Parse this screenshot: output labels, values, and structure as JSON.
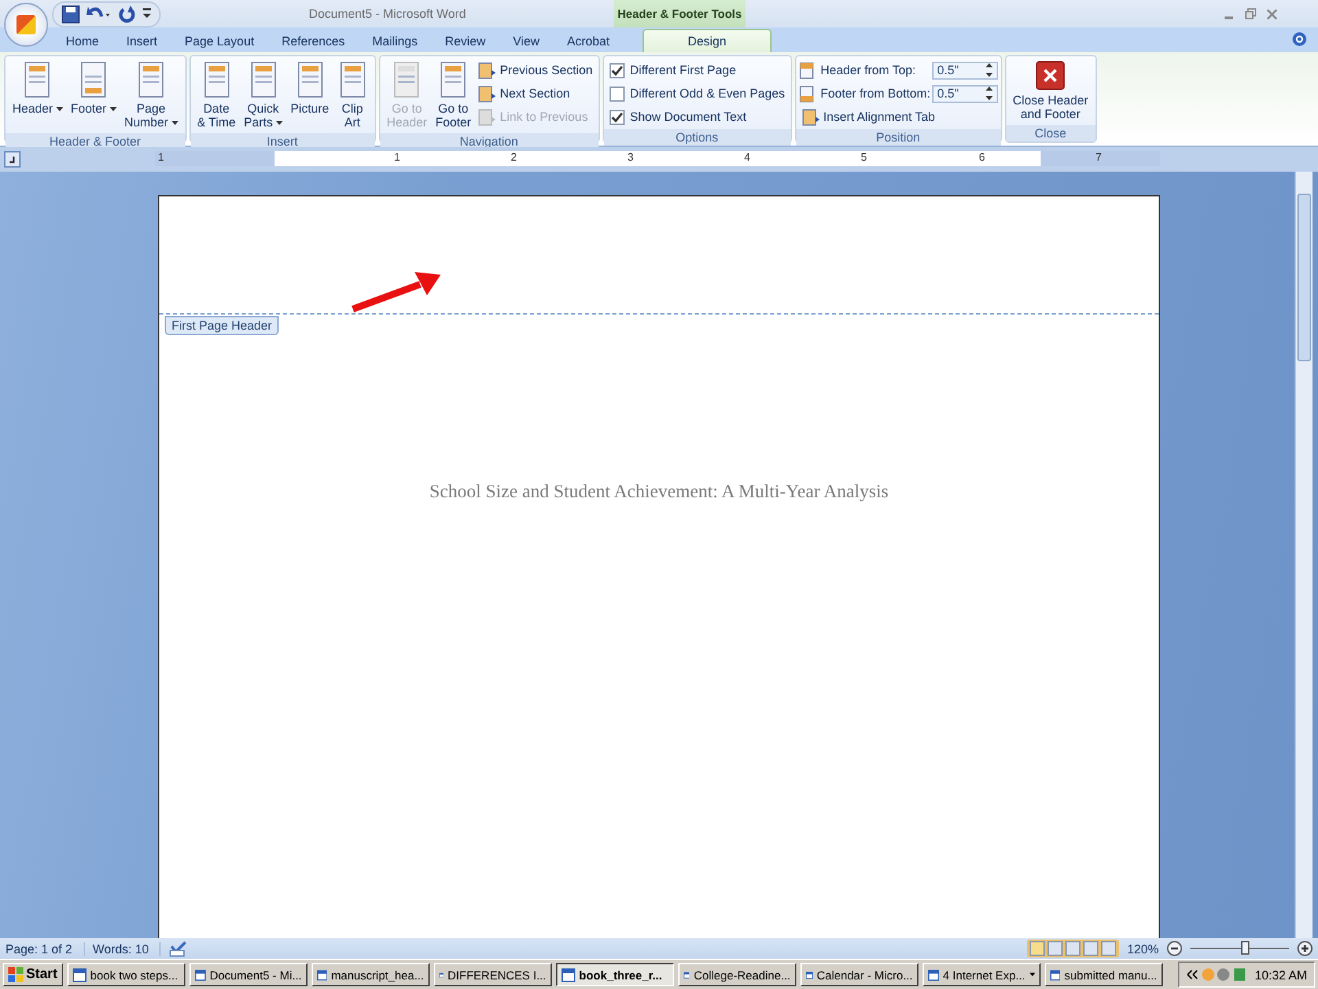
{
  "window": {
    "title": "Document5 - Microsoft Word",
    "context_group": "Header & Footer Tools"
  },
  "tabs": [
    {
      "label": "Home",
      "selected": false
    },
    {
      "label": "Insert",
      "selected": false
    },
    {
      "label": "Page Layout",
      "selected": false
    },
    {
      "label": "References",
      "selected": false
    },
    {
      "label": "Mailings",
      "selected": false
    },
    {
      "label": "Review",
      "selected": false
    },
    {
      "label": "View",
      "selected": false
    },
    {
      "label": "Acrobat",
      "selected": false
    },
    {
      "label": "Design",
      "selected": true
    }
  ],
  "ribbon": [
    {
      "label": "Header & Footer",
      "items": [
        {
          "kind": "large",
          "lines": [
            "Header"
          ],
          "dropdown": true,
          "disabled": false
        },
        {
          "kind": "large",
          "lines": [
            "Footer"
          ],
          "dropdown": true,
          "disabled": false
        },
        {
          "kind": "large",
          "lines": [
            "Page",
            "Number"
          ],
          "dropdown": true,
          "disabled": false
        }
      ]
    },
    {
      "label": "Insert",
      "items": [
        {
          "kind": "large",
          "lines": [
            "Date",
            "& Time"
          ],
          "dropdown": false,
          "disabled": false
        },
        {
          "kind": "large",
          "lines": [
            "Quick",
            "Parts"
          ],
          "dropdown": true,
          "disabled": false
        },
        {
          "kind": "large",
          "lines": [
            "Picture"
          ],
          "dropdown": false,
          "disabled": false
        },
        {
          "kind": "large",
          "lines": [
            "Clip",
            "Art"
          ],
          "dropdown": false,
          "disabled": false
        }
      ]
    },
    {
      "label": "Navigation",
      "items": [
        {
          "kind": "large",
          "lines": [
            "Go to",
            "Header"
          ],
          "dropdown": false,
          "disabled": true
        },
        {
          "kind": "large",
          "lines": [
            "Go to",
            "Footer"
          ],
          "dropdown": false,
          "disabled": false
        },
        {
          "kind": "small",
          "label": "Previous Section",
          "disabled": false
        },
        {
          "kind": "small",
          "label": "Next Section",
          "disabled": false
        },
        {
          "kind": "small",
          "label": "Link to Previous",
          "disabled": true
        }
      ]
    },
    {
      "label": "Options",
      "items": [
        {
          "kind": "checkbox",
          "label": "Different First Page",
          "checked": true
        },
        {
          "kind": "checkbox",
          "label": "Different Odd & Even Pages",
          "checked": false
        },
        {
          "kind": "checkbox",
          "label": "Show Document Text",
          "checked": true
        }
      ]
    },
    {
      "label": "Position",
      "items": [
        {
          "kind": "spin",
          "label": "Header from Top:",
          "value": "0.5\""
        },
        {
          "kind": "spin",
          "label": "Footer from Bottom:",
          "value": "0.5\""
        },
        {
          "kind": "small",
          "label": "Insert Alignment Tab",
          "disabled": false
        }
      ]
    },
    {
      "label": "Close",
      "items": [
        {
          "kind": "close",
          "lines": [
            "Close Header",
            "and Footer"
          ],
          "dropdown": false,
          "disabled": false
        }
      ]
    }
  ],
  "ruler": {
    "numbers": [
      "1",
      "1",
      "2",
      "3",
      "4",
      "5",
      "6",
      "7"
    ]
  },
  "document": {
    "header_tag": "First Page Header",
    "title": "School Size and Student Achievement: A Multi-Year Analysis"
  },
  "status_bar": {
    "page": "Page: 1 of 2",
    "words": "Words: 10",
    "zoom": "120%",
    "level": 0.55
  },
  "taskbar": {
    "start": "Start",
    "clock": "10:32 AM",
    "items": [
      {
        "label": "book two steps...",
        "selected": false,
        "dropdown": false
      },
      {
        "label": "Document5 - Mi...",
        "selected": false,
        "dropdown": false
      },
      {
        "label": "manuscript_hea...",
        "selected": false,
        "dropdown": false
      },
      {
        "label": "DIFFERENCES I...",
        "selected": false,
        "dropdown": false
      },
      {
        "label": "book_three_r...",
        "selected": true,
        "dropdown": false
      },
      {
        "label": "College-Readine...",
        "selected": false,
        "dropdown": false
      },
      {
        "label": "Calendar - Micro...",
        "selected": false,
        "dropdown": false
      },
      {
        "label": "4 Internet Exp...",
        "selected": false,
        "dropdown": true
      },
      {
        "label": "submitted manu...",
        "selected": false,
        "dropdown": false
      }
    ]
  }
}
